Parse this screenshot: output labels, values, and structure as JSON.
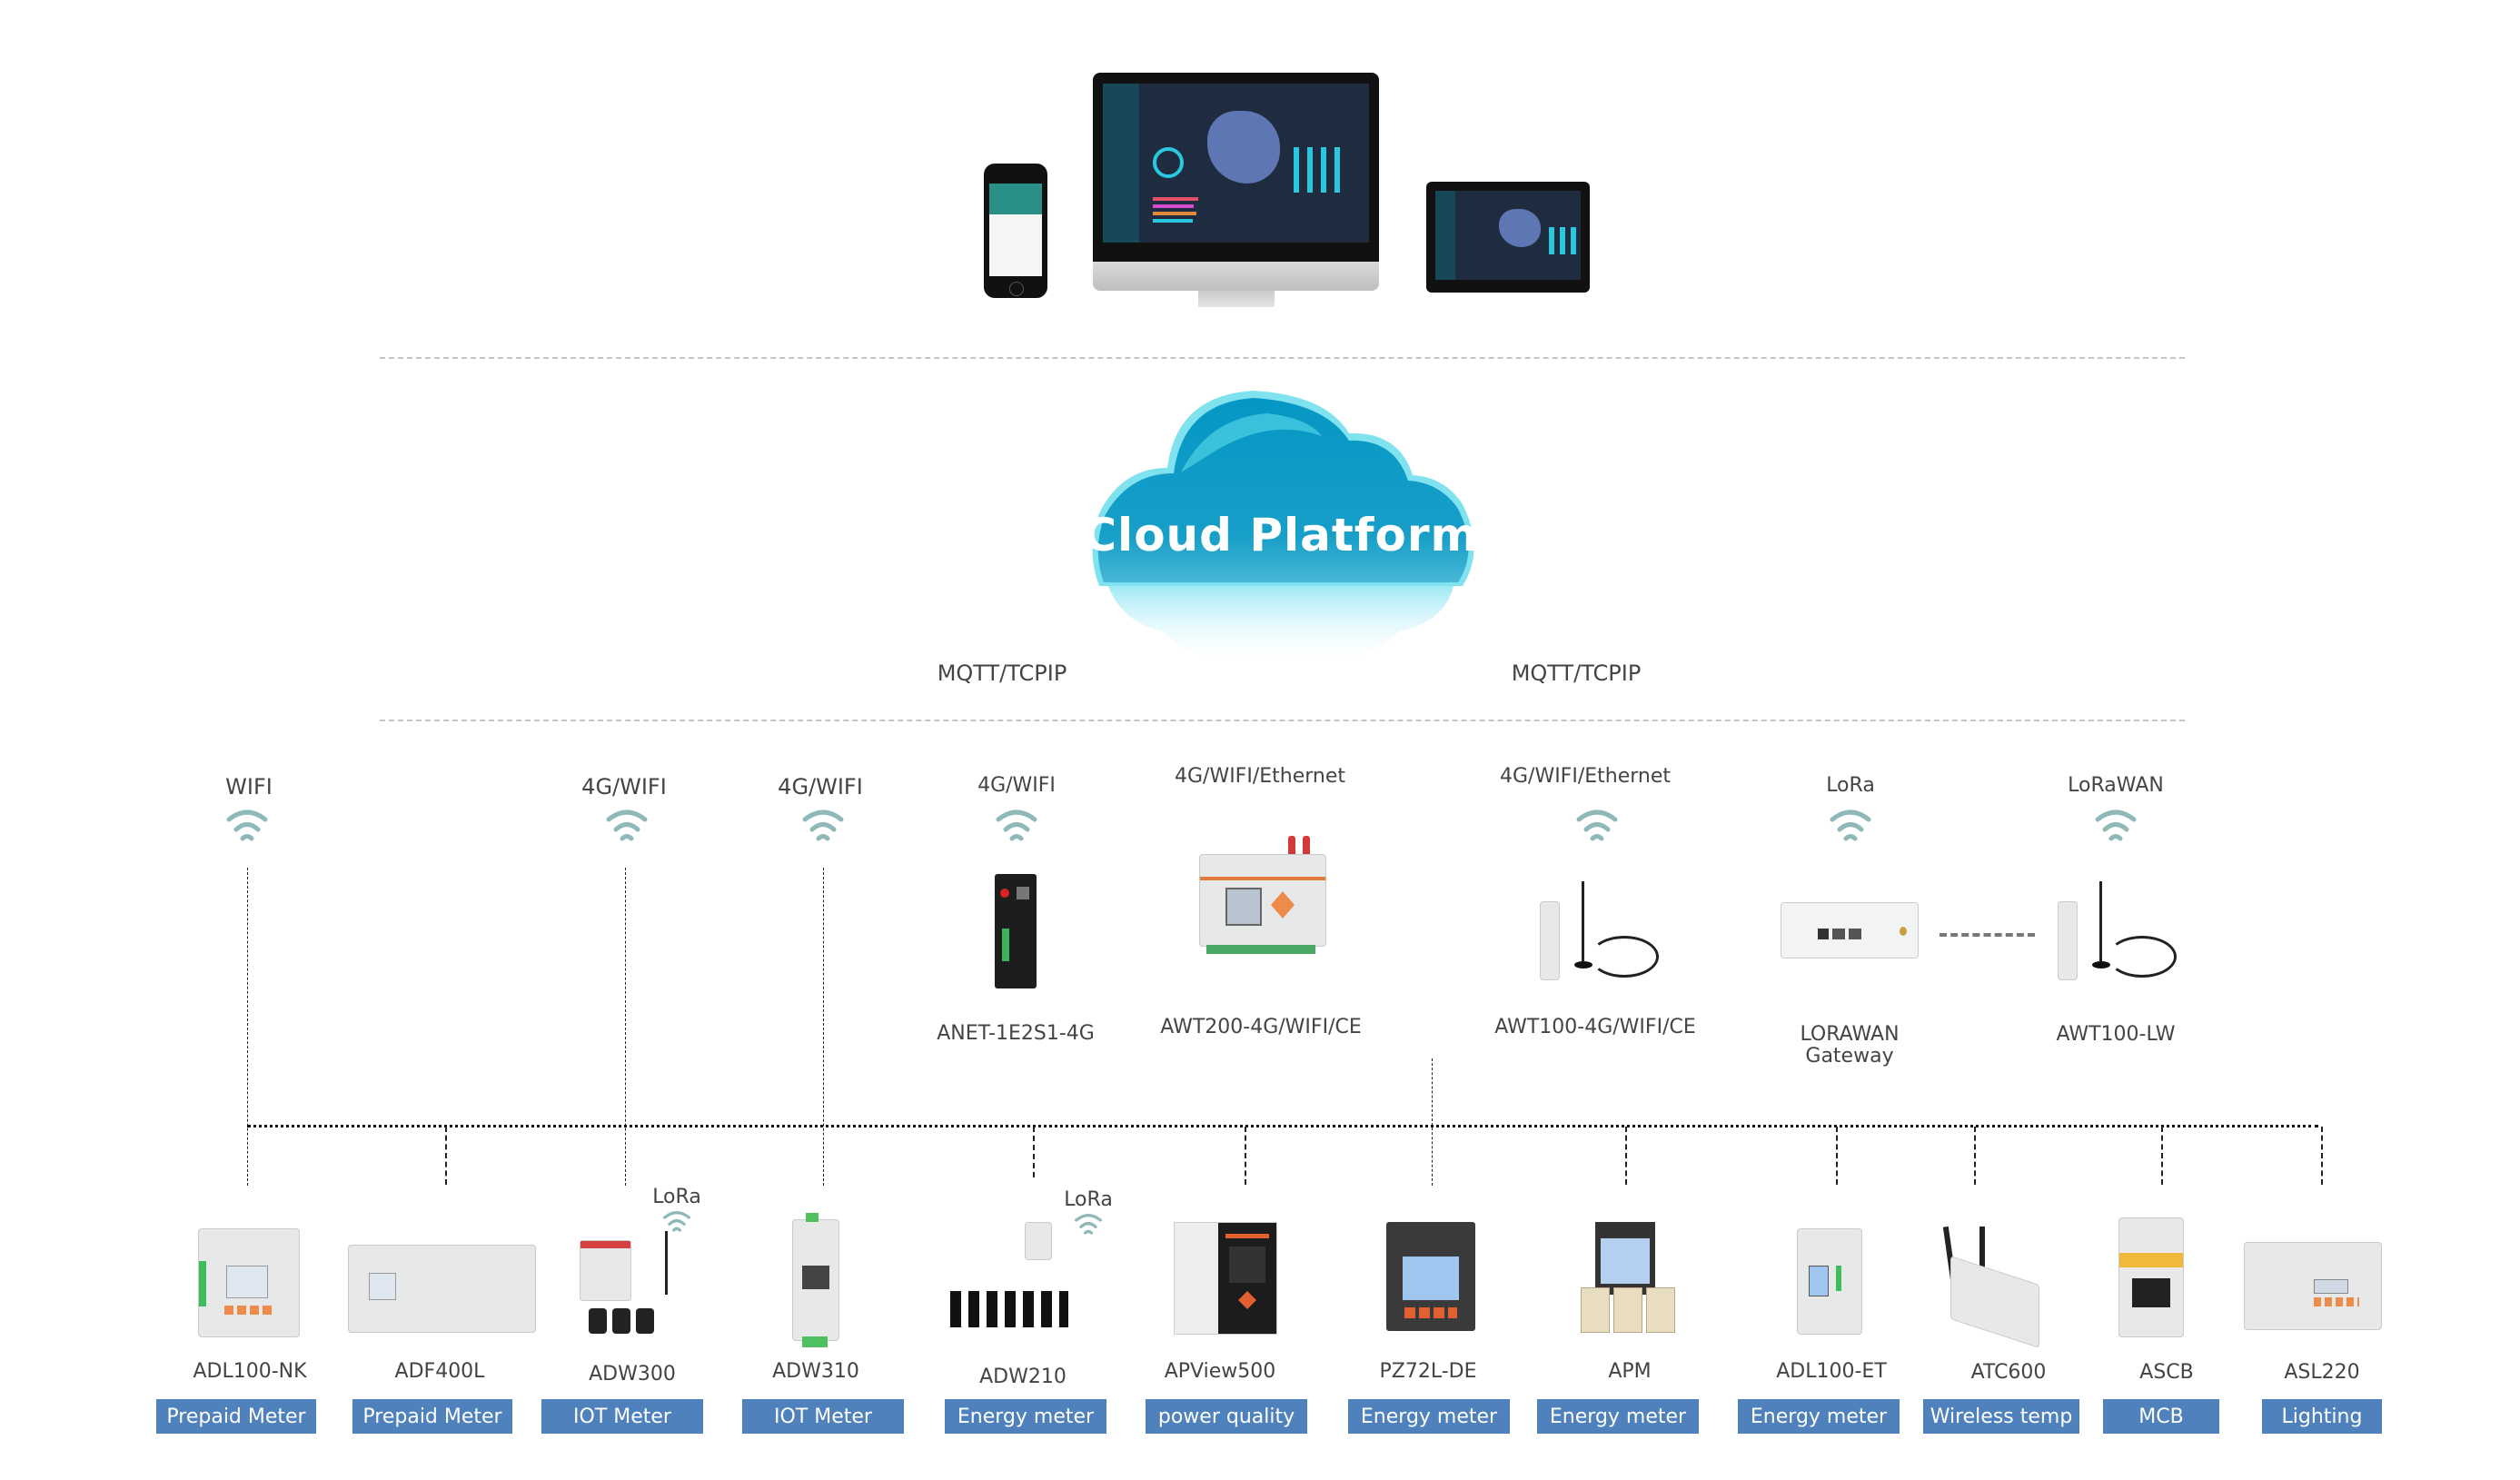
{
  "platform": {
    "title": "Cloud Platform",
    "protocols": [
      "MQTT/TCPIP",
      "MQTT/TCPIP"
    ],
    "clients": [
      "smartphone",
      "desktop-monitor",
      "tablet"
    ]
  },
  "gateways": [
    {
      "connection": "WIFI"
    },
    {
      "connection": "4G/WIFI"
    },
    {
      "connection": "4G/WIFI"
    },
    {
      "connection": "4G/WIFI",
      "device": "ANET-1E2S1-4G"
    },
    {
      "connection": "4G/WIFI/Ethernet",
      "device": "AWT200-4G/WIFI/CE"
    },
    {
      "connection": "4G/WIFI/Ethernet",
      "device": "AWT100-4G/WIFI/CE"
    },
    {
      "connection": "LoRa",
      "device": "LORAWAN",
      "device_line2": "Gateway"
    },
    {
      "connection": "LoRaWAN",
      "device": "AWT100-LW"
    }
  ],
  "field_devices": [
    {
      "model": "ADL100-NK",
      "category": "Prepaid Meter"
    },
    {
      "model": "ADF400L",
      "category": "Prepaid Meter"
    },
    {
      "model": "ADW300",
      "category": "IOT Meter",
      "wireless": "LoRa"
    },
    {
      "model": "ADW310",
      "category": "IOT Meter"
    },
    {
      "model": "ADW210",
      "category": "Energy meter",
      "wireless": "LoRa"
    },
    {
      "model": "APView500",
      "category": "power quality"
    },
    {
      "model": "PZ72L-DE",
      "category": "Energy meter"
    },
    {
      "model": "APM",
      "category": "Energy meter"
    },
    {
      "model": "ADL100-ET",
      "category": "Energy meter"
    },
    {
      "model": "ATC600",
      "category": "Wireless temp"
    },
    {
      "model": "ASCB",
      "category": "MCB"
    },
    {
      "model": "ASL220",
      "category": "Lighting"
    }
  ],
  "colors": {
    "badge": "#4f81bd",
    "cloud": "#0aa3cc",
    "wifi_icon": "#8fb8b8"
  }
}
